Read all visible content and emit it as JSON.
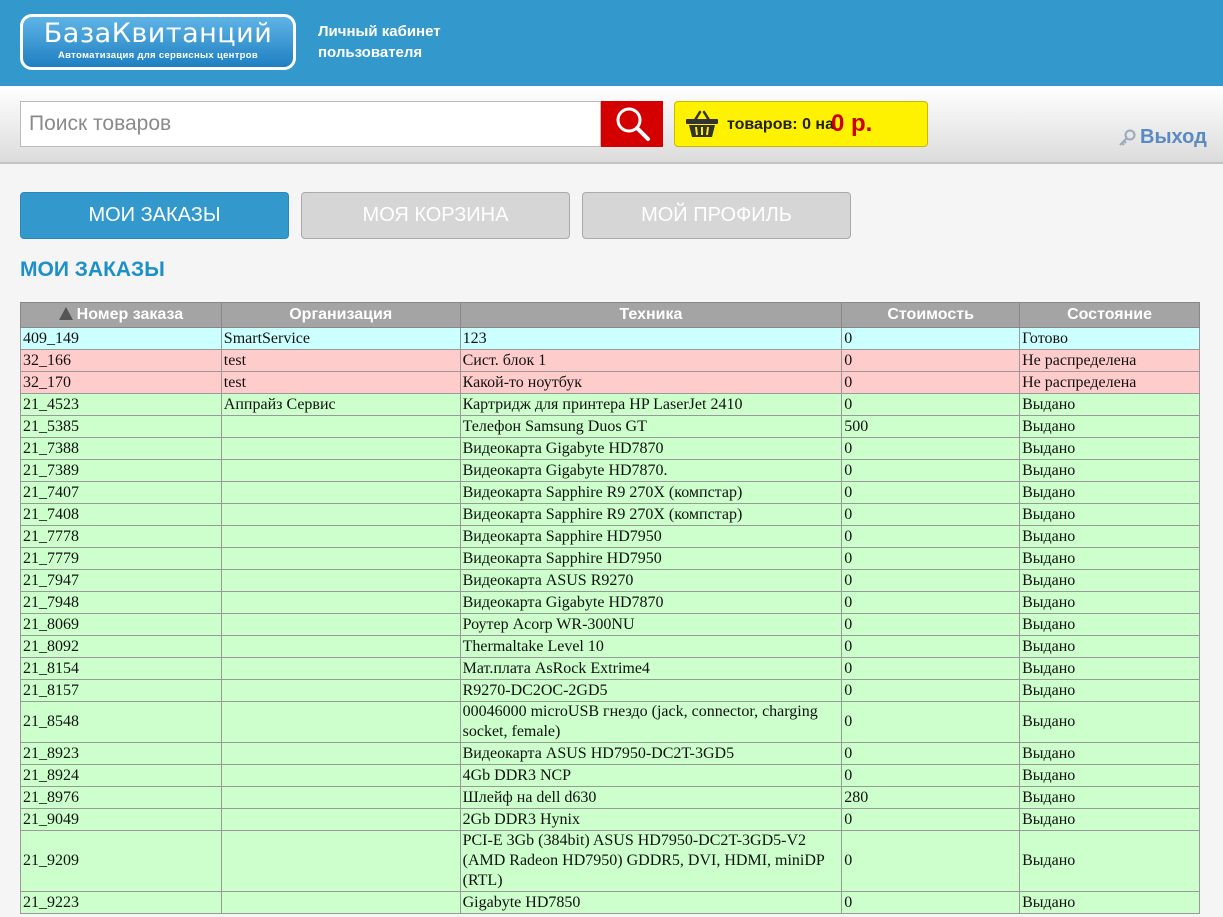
{
  "header": {
    "logo_main": "БазаКвитанций",
    "logo_sub": "Автоматизация для сервисных центров",
    "cabinet_label_line1": "Личный кабинет",
    "cabinet_label_line2": "пользователя"
  },
  "search": {
    "placeholder": "Поиск товаров"
  },
  "cart": {
    "items_text": "товаров: 0 на",
    "sum_text": "0 р."
  },
  "logout_label": "Выход",
  "tabs": [
    {
      "label": "Мои заказы",
      "active": true
    },
    {
      "label": "Моя корзина",
      "active": false
    },
    {
      "label": "Мой профиль",
      "active": false
    }
  ],
  "page_title": "МОИ ЗАКАЗЫ",
  "orders": {
    "columns": [
      "Номер заказа",
      "Организация",
      "Техника",
      "Стоимость",
      "Состояние"
    ],
    "rows": [
      {
        "number": "409_149",
        "org": "SmartService",
        "device": "123",
        "cost": "0",
        "status": "Готово",
        "color": "cyan"
      },
      {
        "number": "32_166",
        "org": "test",
        "device": "Сист. блок 1",
        "cost": "0",
        "status": "Не распределена",
        "color": "pink"
      },
      {
        "number": "32_170",
        "org": "test",
        "device": "Какой-то ноутбук",
        "cost": "0",
        "status": "Не распределена",
        "color": "pink"
      },
      {
        "number": "21_4523",
        "org": "Аппрайз Сервис",
        "device": "Картридж для принтера HP LaserJet 2410",
        "cost": "0",
        "status": "Выдано",
        "color": "green"
      },
      {
        "number": "21_5385",
        "org": "",
        "device": "Телефон Samsung Duos GT",
        "cost": "500",
        "status": "Выдано",
        "color": "green"
      },
      {
        "number": "21_7388",
        "org": "",
        "device": "Видеокарта Gigabyte HD7870",
        "cost": "0",
        "status": "Выдано",
        "color": "green"
      },
      {
        "number": "21_7389",
        "org": "",
        "device": "Видеокарта Gigabyte HD7870.",
        "cost": "0",
        "status": "Выдано",
        "color": "green"
      },
      {
        "number": "21_7407",
        "org": "",
        "device": "Видеокарта Sapphire R9 270X (компстар)",
        "cost": "0",
        "status": "Выдано",
        "color": "green"
      },
      {
        "number": "21_7408",
        "org": "",
        "device": "Видеокарта Sapphire R9 270X (компстар)",
        "cost": "0",
        "status": "Выдано",
        "color": "green"
      },
      {
        "number": "21_7778",
        "org": "",
        "device": "Видеокарта Sapphire HD7950",
        "cost": "0",
        "status": "Выдано",
        "color": "green"
      },
      {
        "number": "21_7779",
        "org": "",
        "device": "Видеокарта Sapphire HD7950",
        "cost": "0",
        "status": "Выдано",
        "color": "green"
      },
      {
        "number": "21_7947",
        "org": "",
        "device": "Видеокарта ASUS R9270",
        "cost": "0",
        "status": "Выдано",
        "color": "green"
      },
      {
        "number": "21_7948",
        "org": "",
        "device": "Видеокарта Gigabyte HD7870",
        "cost": "0",
        "status": "Выдано",
        "color": "green"
      },
      {
        "number": "21_8069",
        "org": "",
        "device": "Роутер Acorp WR-300NU",
        "cost": "0",
        "status": "Выдано",
        "color": "green"
      },
      {
        "number": "21_8092",
        "org": "",
        "device": "Thermaltake Level 10",
        "cost": "0",
        "status": "Выдано",
        "color": "green"
      },
      {
        "number": "21_8154",
        "org": "",
        "device": "Мат.плата AsRock Extrime4",
        "cost": "0",
        "status": "Выдано",
        "color": "green"
      },
      {
        "number": "21_8157",
        "org": "",
        "device": "R9270-DC2OC-2GD5",
        "cost": "0",
        "status": "Выдано",
        "color": "green"
      },
      {
        "number": "21_8548",
        "org": "",
        "device": "00046000 microUSB гнездо (jack, connector, charging socket, female)",
        "cost": "0",
        "status": "Выдано",
        "color": "green"
      },
      {
        "number": "21_8923",
        "org": "",
        "device": "Видеокарта ASUS HD7950-DC2T-3GD5",
        "cost": "0",
        "status": "Выдано",
        "color": "green"
      },
      {
        "number": "21_8924",
        "org": "",
        "device": "4Gb DDR3 NCP",
        "cost": "0",
        "status": "Выдано",
        "color": "green"
      },
      {
        "number": "21_8976",
        "org": "",
        "device": "Шлейф на dell d630",
        "cost": "280",
        "status": "Выдано",
        "color": "green"
      },
      {
        "number": "21_9049",
        "org": "",
        "device": "2Gb DDR3 Hynix",
        "cost": "0",
        "status": "Выдано",
        "color": "green"
      },
      {
        "number": "21_9209",
        "org": "",
        "device": "PCI-E 3Gb (384bit) ASUS HD7950-DC2T-3GD5-V2 (AMD Radeon HD7950) GDDR5, DVI, HDMI, miniDP (RTL)",
        "cost": "0",
        "status": "Выдано",
        "color": "green"
      },
      {
        "number": "21_9223",
        "org": "",
        "device": "Gigabyte HD7850",
        "cost": "0",
        "status": "Выдано",
        "color": "green"
      }
    ]
  },
  "colors": {
    "brand_blue": "#3399cc",
    "search_red": "#d40000",
    "cart_yellow": "#fff200",
    "row_cyan": "#ccffff",
    "row_pink": "#ffcccc",
    "row_green": "#ccffcc"
  }
}
